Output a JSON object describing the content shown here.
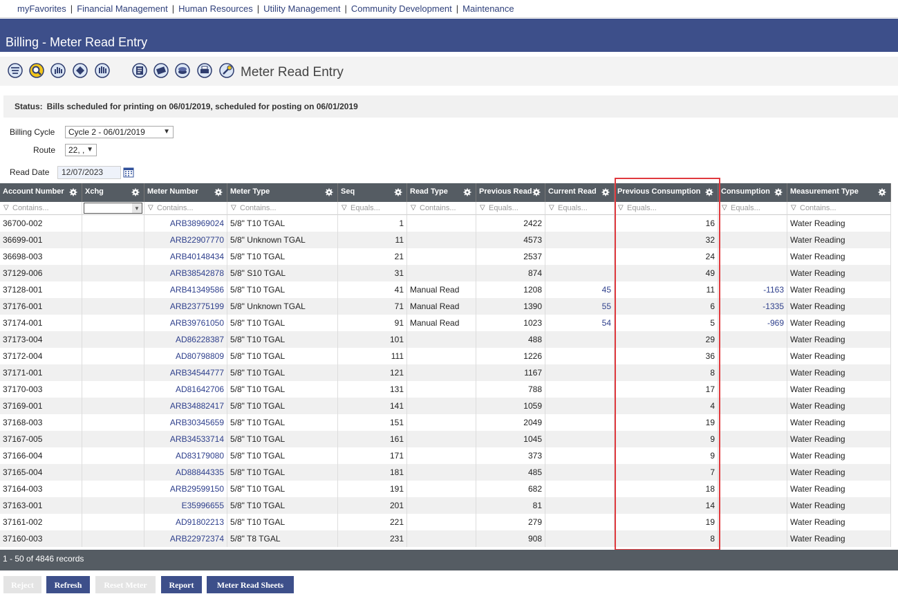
{
  "nav": {
    "items": [
      "myFavorites",
      "Financial Management",
      "Human Resources",
      "Utility Management",
      "Community Development",
      "Maintenance"
    ],
    "separator": "|"
  },
  "page_title": "Billing - Meter Read Entry",
  "toolbar": {
    "title": "Meter Read Entry",
    "icons": [
      "list-icon",
      "search-icon",
      "hand-icon",
      "tag-icon",
      "hand-stop-icon",
      "bill-icon",
      "money-icon",
      "coins-icon",
      "print-icon",
      "tools-icon"
    ]
  },
  "status": {
    "label": "Status:",
    "text": "Bills scheduled for printing on 06/01/2019, scheduled for posting on 06/01/2019"
  },
  "form": {
    "billing_cycle_label": "Billing Cycle",
    "billing_cycle_value": "Cycle 2 - 06/01/2019",
    "route_label": "Route",
    "route_value": "22, ,",
    "read_date_label": "Read Date",
    "read_date_value": "12/07/2023"
  },
  "grid": {
    "columns": [
      "Account Number",
      "Xchg",
      "Meter Number",
      "Meter Type",
      "Seq",
      "Read Type",
      "Previous Read",
      "Current Read",
      "Previous Consumption",
      "Consumption",
      "Measurement Type"
    ],
    "filters": [
      "Contains...",
      "",
      "Contains...",
      "Contains...",
      "Equals...",
      "Contains...",
      "Equals...",
      "Equals...",
      "Equals...",
      "Equals...",
      "Contains..."
    ],
    "rows": [
      {
        "account": "36700-002",
        "meter": "ARB38969024",
        "type": "5/8\" T10 TGAL",
        "seq": "1",
        "read_type": "",
        "prev_read": "2422",
        "cur_read": "",
        "prev_cons": "16",
        "cons": "",
        "measure": "Water Reading"
      },
      {
        "account": "36699-001",
        "meter": "ARB22907770",
        "type": "5/8\" Unknown TGAL",
        "seq": "11",
        "read_type": "",
        "prev_read": "4573",
        "cur_read": "",
        "prev_cons": "32",
        "cons": "",
        "measure": "Water Reading"
      },
      {
        "account": "36698-003",
        "meter": "ARB40148434",
        "type": "5/8\" T10 TGAL",
        "seq": "21",
        "read_type": "",
        "prev_read": "2537",
        "cur_read": "",
        "prev_cons": "24",
        "cons": "",
        "measure": "Water Reading"
      },
      {
        "account": "37129-006",
        "meter": "ARB38542878",
        "type": "5/8\" S10 TGAL",
        "seq": "31",
        "read_type": "",
        "prev_read": "874",
        "cur_read": "",
        "prev_cons": "49",
        "cons": "",
        "measure": "Water Reading"
      },
      {
        "account": "37128-001",
        "meter": "ARB41349586",
        "type": "5/8\" T10 TGAL",
        "seq": "41",
        "read_type": "Manual Read",
        "prev_read": "1208",
        "cur_read": "45",
        "prev_cons": "11",
        "cons": "-1163",
        "measure": "Water Reading"
      },
      {
        "account": "37176-001",
        "meter": "ARB23775199",
        "type": "5/8\" Unknown TGAL",
        "seq": "71",
        "read_type": "Manual Read",
        "prev_read": "1390",
        "cur_read": "55",
        "prev_cons": "6",
        "cons": "-1335",
        "measure": "Water Reading"
      },
      {
        "account": "37174-001",
        "meter": "ARB39761050",
        "type": "5/8\" T10 TGAL",
        "seq": "91",
        "read_type": "Manual Read",
        "prev_read": "1023",
        "cur_read": "54",
        "prev_cons": "5",
        "cons": "-969",
        "measure": "Water Reading"
      },
      {
        "account": "37173-004",
        "meter": "AD86228387",
        "type": "5/8\" T10 TGAL",
        "seq": "101",
        "read_type": "",
        "prev_read": "488",
        "cur_read": "",
        "prev_cons": "29",
        "cons": "",
        "measure": "Water Reading"
      },
      {
        "account": "37172-004",
        "meter": "AD80798809",
        "type": "5/8\" T10 TGAL",
        "seq": "111",
        "read_type": "",
        "prev_read": "1226",
        "cur_read": "",
        "prev_cons": "36",
        "cons": "",
        "measure": "Water Reading"
      },
      {
        "account": "37171-001",
        "meter": "ARB34544777",
        "type": "5/8\" T10 TGAL",
        "seq": "121",
        "read_type": "",
        "prev_read": "1167",
        "cur_read": "",
        "prev_cons": "8",
        "cons": "",
        "measure": "Water Reading"
      },
      {
        "account": "37170-003",
        "meter": "AD81642706",
        "type": "5/8\" T10 TGAL",
        "seq": "131",
        "read_type": "",
        "prev_read": "788",
        "cur_read": "",
        "prev_cons": "17",
        "cons": "",
        "measure": "Water Reading"
      },
      {
        "account": "37169-001",
        "meter": "ARB34882417",
        "type": "5/8\" T10 TGAL",
        "seq": "141",
        "read_type": "",
        "prev_read": "1059",
        "cur_read": "",
        "prev_cons": "4",
        "cons": "",
        "measure": "Water Reading"
      },
      {
        "account": "37168-003",
        "meter": "ARB30345659",
        "type": "5/8\" T10 TGAL",
        "seq": "151",
        "read_type": "",
        "prev_read": "2049",
        "cur_read": "",
        "prev_cons": "19",
        "cons": "",
        "measure": "Water Reading"
      },
      {
        "account": "37167-005",
        "meter": "ARB34533714",
        "type": "5/8\" T10 TGAL",
        "seq": "161",
        "read_type": "",
        "prev_read": "1045",
        "cur_read": "",
        "prev_cons": "9",
        "cons": "",
        "measure": "Water Reading"
      },
      {
        "account": "37166-004",
        "meter": "AD83179080",
        "type": "5/8\" T10 TGAL",
        "seq": "171",
        "read_type": "",
        "prev_read": "373",
        "cur_read": "",
        "prev_cons": "9",
        "cons": "",
        "measure": "Water Reading"
      },
      {
        "account": "37165-004",
        "meter": "AD88844335",
        "type": "5/8\" T10 TGAL",
        "seq": "181",
        "read_type": "",
        "prev_read": "485",
        "cur_read": "",
        "prev_cons": "7",
        "cons": "",
        "measure": "Water Reading"
      },
      {
        "account": "37164-003",
        "meter": "ARB29599150",
        "type": "5/8\" T10 TGAL",
        "seq": "191",
        "read_type": "",
        "prev_read": "682",
        "cur_read": "",
        "prev_cons": "18",
        "cons": "",
        "measure": "Water Reading"
      },
      {
        "account": "37163-001",
        "meter": "E35996655",
        "type": "5/8\" T10 TGAL",
        "seq": "201",
        "read_type": "",
        "prev_read": "81",
        "cur_read": "",
        "prev_cons": "14",
        "cons": "",
        "measure": "Water Reading"
      },
      {
        "account": "37161-002",
        "meter": "AD91802213",
        "type": "5/8\" T10 TGAL",
        "seq": "221",
        "read_type": "",
        "prev_read": "279",
        "cur_read": "",
        "prev_cons": "19",
        "cons": "",
        "measure": "Water Reading"
      },
      {
        "account": "37160-003",
        "meter": "ARB22972374",
        "type": "5/8\" T8 TGAL",
        "seq": "231",
        "read_type": "",
        "prev_read": "908",
        "cur_read": "",
        "prev_cons": "8",
        "cons": "",
        "measure": "Water Reading"
      }
    ],
    "footer": "1 - 50 of 4846 records"
  },
  "buttons": {
    "reject": "Reject",
    "refresh": "Refresh",
    "reset_meter": "Reset Meter",
    "report": "Report",
    "meter_read_sheets": "Meter Read Sheets"
  },
  "colors": {
    "header_bar": "#3d4f8a",
    "grid_header": "#555c63",
    "link": "#2e3f8c",
    "highlight": "#e0393e"
  }
}
